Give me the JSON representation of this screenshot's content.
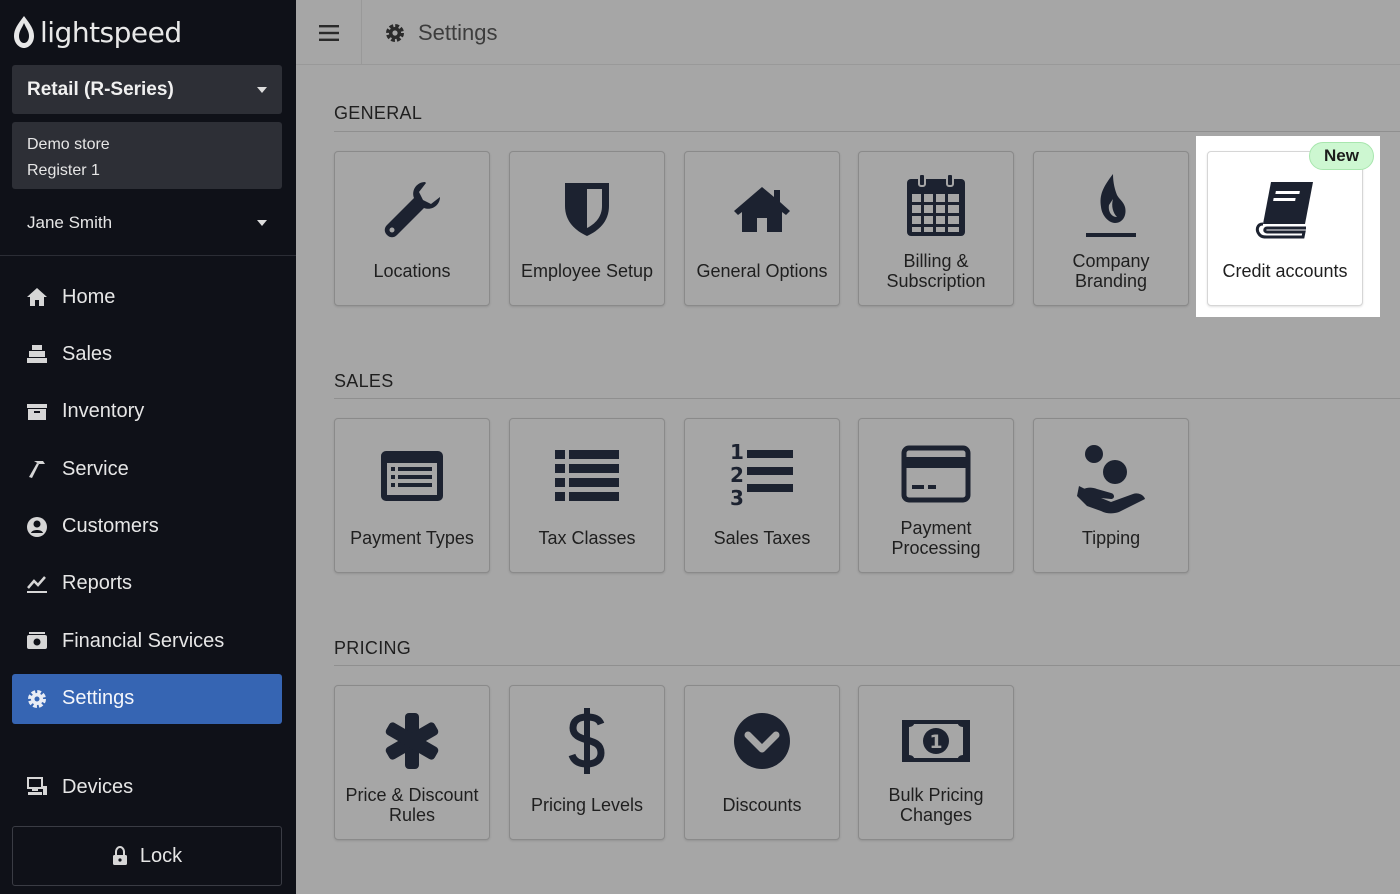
{
  "brand": {
    "name": "lightspeed"
  },
  "sidebar": {
    "product": "Retail (R-Series)",
    "store": "Demo store",
    "register": "Register 1",
    "user": "Jane Smith",
    "items": [
      {
        "label": "Home",
        "icon": "home-icon"
      },
      {
        "label": "Sales",
        "icon": "register-icon"
      },
      {
        "label": "Inventory",
        "icon": "inventory-icon"
      },
      {
        "label": "Service",
        "icon": "hammer-icon"
      },
      {
        "label": "Customers",
        "icon": "customer-icon"
      },
      {
        "label": "Reports",
        "icon": "chart-icon"
      },
      {
        "label": "Financial Services",
        "icon": "bank-icon"
      },
      {
        "label": "Settings",
        "icon": "gear-icon",
        "active": true
      }
    ],
    "devices": "Devices",
    "lock": "Lock"
  },
  "header": {
    "title": "Settings"
  },
  "sections": [
    {
      "title": "GENERAL",
      "tiles": [
        {
          "label": "Locations",
          "icon": "wrench-icon"
        },
        {
          "label": "Employee Setup",
          "icon": "shield-icon"
        },
        {
          "label": "General Options",
          "icon": "house-icon"
        },
        {
          "label": "Billing & Subscription",
          "icon": "calendar-icon"
        },
        {
          "label": "Company Branding",
          "icon": "flame-icon"
        },
        {
          "label": "Credit accounts",
          "icon": "book-icon",
          "badge": "New"
        }
      ]
    },
    {
      "title": "SALES",
      "tiles": [
        {
          "label": "Payment Types",
          "icon": "list-card-icon"
        },
        {
          "label": "Tax Classes",
          "icon": "list-icon"
        },
        {
          "label": "Sales Taxes",
          "icon": "ordered-list-icon"
        },
        {
          "label": "Payment Processing",
          "icon": "credit-card-icon"
        },
        {
          "label": "Tipping",
          "icon": "hand-coins-icon"
        }
      ]
    },
    {
      "title": "PRICING",
      "tiles": [
        {
          "label": "Price & Discount Rules",
          "icon": "asterisk-icon"
        },
        {
          "label": "Pricing Levels",
          "icon": "dollar-icon"
        },
        {
          "label": "Discounts",
          "icon": "chevron-circle-icon"
        },
        {
          "label": "Bulk Pricing Changes",
          "icon": "banknote-icon"
        }
      ]
    }
  ],
  "colors": {
    "sidebar_bg": "#0f1118",
    "active_nav": "#3665b3",
    "icon": "#1c2230",
    "badge": "#cdf7d1"
  }
}
